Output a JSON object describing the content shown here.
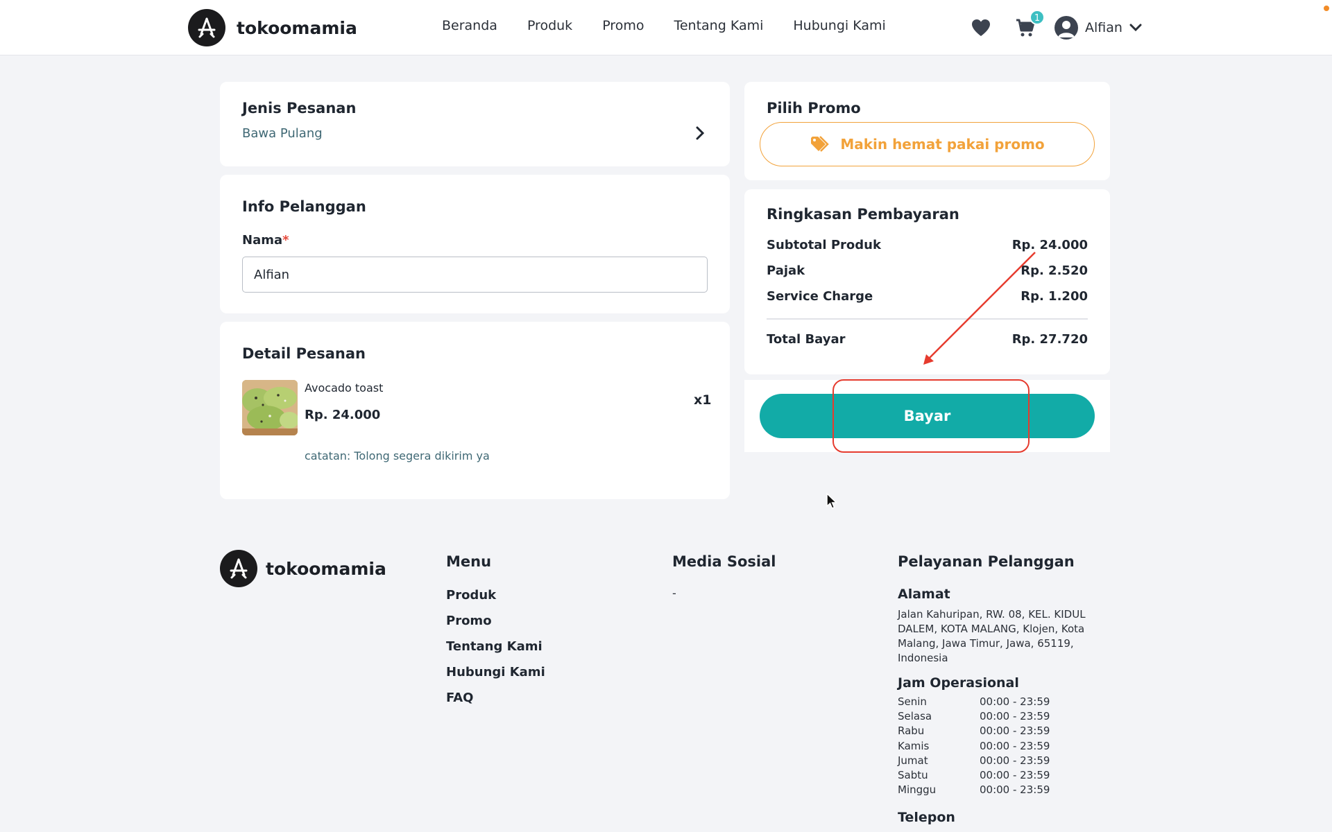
{
  "header": {
    "brand": "tokoomamia",
    "nav": [
      "Beranda",
      "Produk",
      "Promo",
      "Tentang Kami",
      "Hubungi Kami"
    ],
    "cart_count": "1",
    "user_name": "Alfian"
  },
  "order_type": {
    "title": "Jenis Pesanan",
    "value": "Bawa Pulang"
  },
  "customer": {
    "title": "Info Pelanggan",
    "name_label": "Nama",
    "required_mark": "*",
    "name_value": "Alfian"
  },
  "details": {
    "title": "Detail Pesanan",
    "item_name": "Avocado toast",
    "item_price": "Rp. 24.000",
    "item_qty": "x1",
    "item_note": "catatan: Tolong segera dikirim ya"
  },
  "promo": {
    "title": "Pilih Promo",
    "button_label": "Makin hemat pakai promo"
  },
  "summary": {
    "title": "Ringkasan Pembayaran",
    "rows": [
      {
        "label": "Subtotal Produk",
        "value": "Rp. 24.000"
      },
      {
        "label": "Pajak",
        "value": "Rp. 2.520"
      },
      {
        "label": "Service Charge",
        "value": "Rp. 1.200"
      }
    ],
    "total_label": "Total Bayar",
    "total_value": "Rp. 27.720"
  },
  "pay_button": "Bayar",
  "footer": {
    "brand": "tokoomamia",
    "menu_title": "Menu",
    "menu": [
      "Produk",
      "Promo",
      "Tentang Kami",
      "Hubungi Kami",
      "FAQ"
    ],
    "social_title": "Media Sosial",
    "social_value": "-",
    "service_title": "Pelayanan Pelanggan",
    "address_title": "Alamat",
    "address": "Jalan Kahuripan, RW. 08, KEL. KIDUL DALEM, KOTA MALANG, Klojen, Kota Malang, Jawa Timur, Jawa, 65119, Indonesia",
    "hours_title": "Jam Operasional",
    "hours": [
      {
        "day": "Senin",
        "time": "00:00 - 23:59"
      },
      {
        "day": "Selasa",
        "time": "00:00 - 23:59"
      },
      {
        "day": "Rabu",
        "time": "00:00 - 23:59"
      },
      {
        "day": "Kamis",
        "time": "00:00 - 23:59"
      },
      {
        "day": "Jumat",
        "time": "00:00 - 23:59"
      },
      {
        "day": "Sabtu",
        "time": "00:00 - 23:59"
      },
      {
        "day": "Minggu",
        "time": "00:00 - 23:59"
      }
    ],
    "phone_title": "Telepon"
  },
  "colors": {
    "primary": "#12aba7",
    "promo": "#f2a23a",
    "annotation": "#e63b2e"
  },
  "icons": [
    "logo-icon",
    "heart-icon",
    "cart-icon",
    "user-icon",
    "chevron-down-icon",
    "chevron-right-icon",
    "tag-icon",
    "cursor-icon"
  ]
}
